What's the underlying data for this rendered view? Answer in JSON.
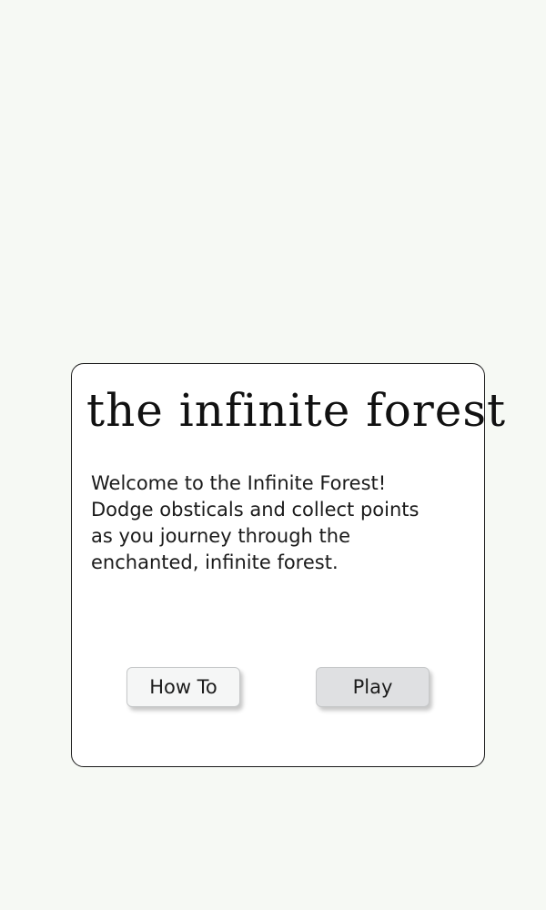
{
  "title": "the infinite forest",
  "intro": {
    "lines": [
      "Welcome to the Infinite Forest!",
      "Dodge obsticals and collect points",
      "as you journey through the",
      "enchanted, infinite forest."
    ]
  },
  "buttons": {
    "how_to": "How To",
    "play": "Play"
  }
}
